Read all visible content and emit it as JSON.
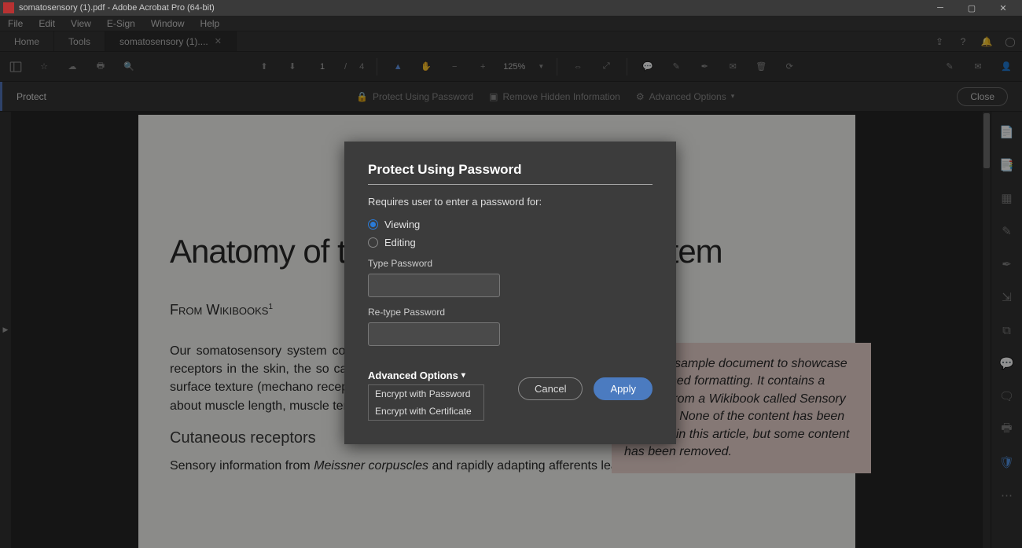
{
  "window": {
    "title": "somatosensory (1).pdf - Adobe Acrobat Pro (64-bit)"
  },
  "menu": {
    "items": [
      "File",
      "Edit",
      "View",
      "E-Sign",
      "Window",
      "Help"
    ]
  },
  "tabs": {
    "home": "Home",
    "tools": "Tools",
    "doc": "somatosensory (1)...."
  },
  "toolbar": {
    "page_current": "1",
    "page_separator": "/",
    "page_total": "4",
    "zoom": "125%"
  },
  "protectbar": {
    "label": "Protect",
    "protect_pw": "Protect Using Password",
    "remove_hidden": "Remove Hidden Information",
    "advanced": "Advanced Options",
    "close": "Close"
  },
  "document": {
    "title": "Anatomy of the Somatosensory System",
    "from": "From Wikibooks",
    "from_sup": "1",
    "para1": "Our somatosensory system consists of sensors in the skin and sensors in our muscles, tendons, and joints. The receptors in the skin, the so called cutaneous receptors, tell us about temperature (thermoreceptors), pressure and surface texture (mechano receptors), and pain (nociceptors). The receptors in muscles and joints provide information about muscle length, muscle tension, and joint angles.",
    "h2": "Cutaneous receptors",
    "para2_a": "Sensory information from ",
    "para2_em": "Meissner corpuscles",
    "para2_b": " and rapidly adapting afferents leads to adjustment of grip force when",
    "sidebox": "This is a sample document to showcase page-based formatting. It contains a chapter from a Wikibook called Sensory Systems. None of the content has been changed in this article, but some content has been removed."
  },
  "dialog": {
    "title": "Protect Using Password",
    "hint": "Requires user to enter a password for:",
    "radio_viewing": "Viewing",
    "radio_editing": "Editing",
    "type_pw": "Type Password",
    "retype_pw": "Re-type Password",
    "advanced": "Advanced Options",
    "menu1": "Encrypt with Password",
    "menu2": "Encrypt with Certificate",
    "cancel": "Cancel",
    "apply": "Apply"
  }
}
